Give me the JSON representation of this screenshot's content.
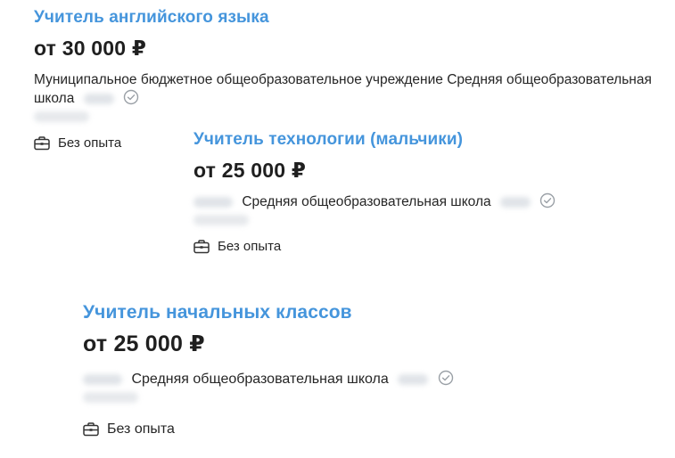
{
  "vacancies": [
    {
      "title": "Учитель английского языка",
      "salary": "от 30 000 ₽",
      "company": "Муниципальное бюджетное общеобразовательное учреждение Средняя общеобразовательная школа",
      "experience": "Без опыта",
      "verified_icon": "check-circle-icon",
      "experience_icon": "briefcase-icon"
    },
    {
      "title": "Учитель технологии (мальчики)",
      "salary": "от 25 000 ₽",
      "company": "Средняя общеобразовательная школа",
      "experience": "Без опыта",
      "verified_icon": "check-circle-icon",
      "experience_icon": "briefcase-icon"
    },
    {
      "title": "Учитель начальных классов",
      "salary": "от 25 000 ₽",
      "company": "Средняя общеобразовательная школа",
      "experience": "Без опыта",
      "verified_icon": "check-circle-icon",
      "experience_icon": "briefcase-icon"
    }
  ],
  "colors": {
    "title_link": "#4595dc",
    "text": "#1f1f1f",
    "icon": "#9aa0a6"
  }
}
